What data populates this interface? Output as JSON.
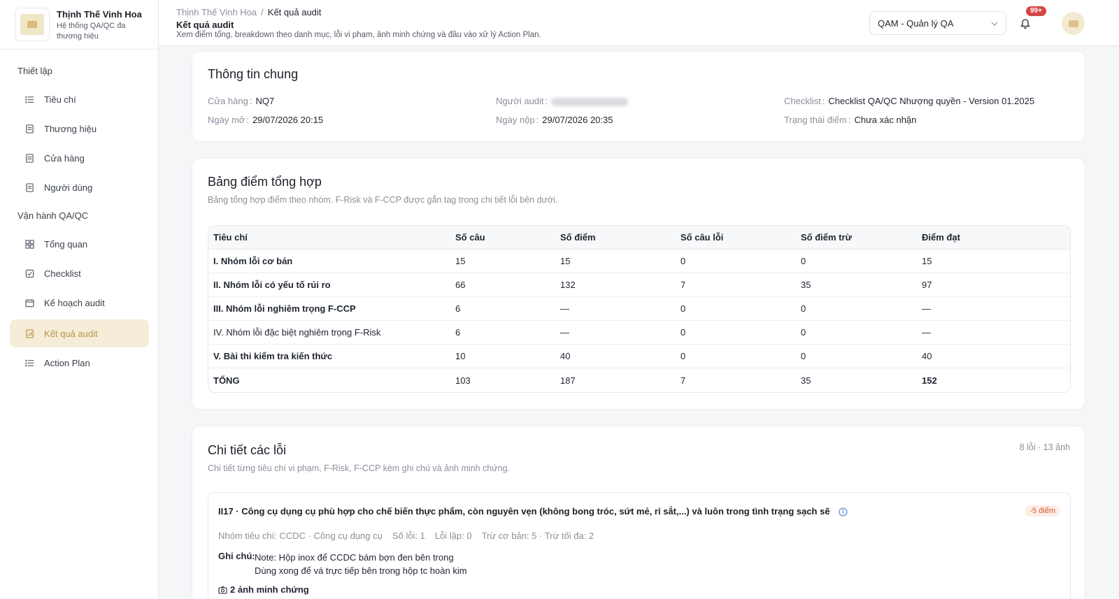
{
  "brand": {
    "title": "Thịnh Thế Vinh Hoa",
    "subtitle": "Hệ thống QA/QC đa thương hiệu"
  },
  "sidebar": {
    "sections": [
      {
        "label": "Thiết lập"
      },
      {
        "label": "Vận hành QA/QC"
      }
    ],
    "items": [
      {
        "label": "Tiêu chí",
        "icon": "list-icon"
      },
      {
        "label": "Thương hiệu",
        "icon": "document-icon"
      },
      {
        "label": "Cửa hàng",
        "icon": "document-icon"
      },
      {
        "label": "Người dùng",
        "icon": "document-icon"
      },
      {
        "label": "Tổng quan",
        "icon": "grid-icon"
      },
      {
        "label": "Checklist",
        "icon": "checkbox-icon"
      },
      {
        "label": "Kế hoạch audit",
        "icon": "calendar-icon"
      },
      {
        "label": "Kết quả audit",
        "icon": "report-icon",
        "active": true
      },
      {
        "label": "Action Plan",
        "icon": "list-icon"
      }
    ]
  },
  "header": {
    "breadcrumb": [
      "Thịnh Thế Vinh Hoa",
      "Kết quả audit"
    ],
    "title": "Kết quả audit",
    "description": "Xem điểm tổng, breakdown theo danh mục, lỗi vi phạm, ảnh minh chứng và đầu vào xử lý Action Plan.",
    "role": "QAM - Quản lý QA",
    "notifications": "99+"
  },
  "general": {
    "title": "Thông tin chung",
    "store_label": "Cửa hàng",
    "store": "NQ7",
    "auditor_label": "Người audit",
    "checklist_label": "Checklist",
    "checklist": "Checklist QA/QC Nhượng quyền - Version 01.2025",
    "opened_label": "Ngày mở",
    "opened": "29/07/2026 20:15",
    "submitted_label": "Ngày nộp",
    "submitted": "29/07/2026 20:35",
    "status_label": "Trạng thái điểm",
    "status": "Chưa xác nhận"
  },
  "summary": {
    "title": "Bảng điểm tổng hợp",
    "subtitle": "Bảng tổng hợp điểm theo nhóm. F-Risk và F-CCP được gắn tag trong chi tiết lỗi bên dưới.",
    "columns": [
      "Tiêu chí",
      "Số câu",
      "Số điểm",
      "Số câu lỗi",
      "Số điểm trừ",
      "Điểm đạt"
    ],
    "rows": [
      [
        "I. Nhóm lỗi cơ bản",
        "15",
        "15",
        "0",
        "0",
        "15"
      ],
      [
        "II. Nhóm lỗi có yếu tố rủi ro",
        "66",
        "132",
        "7",
        "35",
        "97"
      ],
      [
        "III. Nhóm lỗi nghiêm trọng F-CCP",
        "6",
        "—",
        "0",
        "0",
        "—"
      ],
      [
        "IV. Nhóm lỗi đặc biệt nghiêm trọng F-Risk",
        "6",
        "—",
        "0",
        "0",
        "—"
      ],
      [
        "V. Bài thi kiểm tra kiến thức",
        "10",
        "40",
        "0",
        "0",
        "40"
      ],
      [
        "TỔNG",
        "103",
        "187",
        "7",
        "35",
        "152"
      ]
    ]
  },
  "details": {
    "title": "Chi tiết các lỗi",
    "subtitle": "Chi tiết từng tiêu chí vi phạm, F-Risk, F-CCP kèm ghi chú và ảnh minh chứng.",
    "count": "8 lỗi · 13 ảnh",
    "error": {
      "title": "II17 · Công cụ dụng cụ phù hợp cho chế biến thực phẩm, còn nguyên vẹn (không bong tróc, sứt mẻ, rỉ sắt,...) và luôn trong tình trạng sạch sẽ",
      "penalty": "-5 điểm",
      "group": "Nhóm tiêu chí: CCDC · Công cụ dụng cụ",
      "errors": "Số lỗi: 1",
      "repeat": "Lỗi lặp: 0",
      "deduct": "Trừ cơ bản: 5 · Trừ tối đa: 2",
      "note_label": "Ghi chú:",
      "note_line1": "Note: Hộp inox để CCDC bám bợn đen bên trong",
      "note_line2": "Dùng xong để vá trực tiếp bên trong hộp tc hoàn kim",
      "photos": "2 ảnh minh chứng"
    }
  },
  "colors": {
    "accent": "#c29a43",
    "active_bg": "#f6edd8",
    "badge": "#d64545"
  }
}
